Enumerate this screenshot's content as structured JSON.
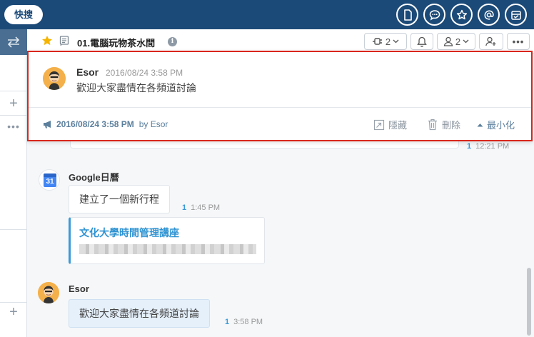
{
  "topbar": {
    "search_label": "快搜",
    "icons": [
      "document-icon",
      "chat-bubble-icon",
      "star-icon",
      "at-icon",
      "inbox-icon"
    ]
  },
  "channel": {
    "title": "01.電腦玩物茶水間",
    "info": "i",
    "plugin_count": "2",
    "member_count": "2"
  },
  "announcement": {
    "sender": "Esor",
    "time": "2016/08/24 3:58 PM",
    "text": "歡迎大家盡情在各頻道討論",
    "footer_date": "2016/08/24 3:58 PM",
    "footer_by": "by Esor",
    "hide_label": "隱藏",
    "delete_label": "刪除",
    "minimize_label": "最小化"
  },
  "messages": {
    "prev_read": "1",
    "prev_time": "12:21 PM",
    "google": {
      "sender": "Google日曆",
      "icon_day": "31",
      "text": "建立了一個新行程",
      "read": "1",
      "time": "1:45 PM",
      "card_title": "文化大學時間管理講座"
    },
    "esor": {
      "sender": "Esor",
      "text": "歡迎大家盡情在各頻道討論",
      "read": "1",
      "time": "3:58 PM"
    }
  },
  "colors": {
    "topbar": "#1c4a78",
    "accent": "#3a9ad9",
    "highlight_border": "#d9261c",
    "star": "#f5b400"
  }
}
